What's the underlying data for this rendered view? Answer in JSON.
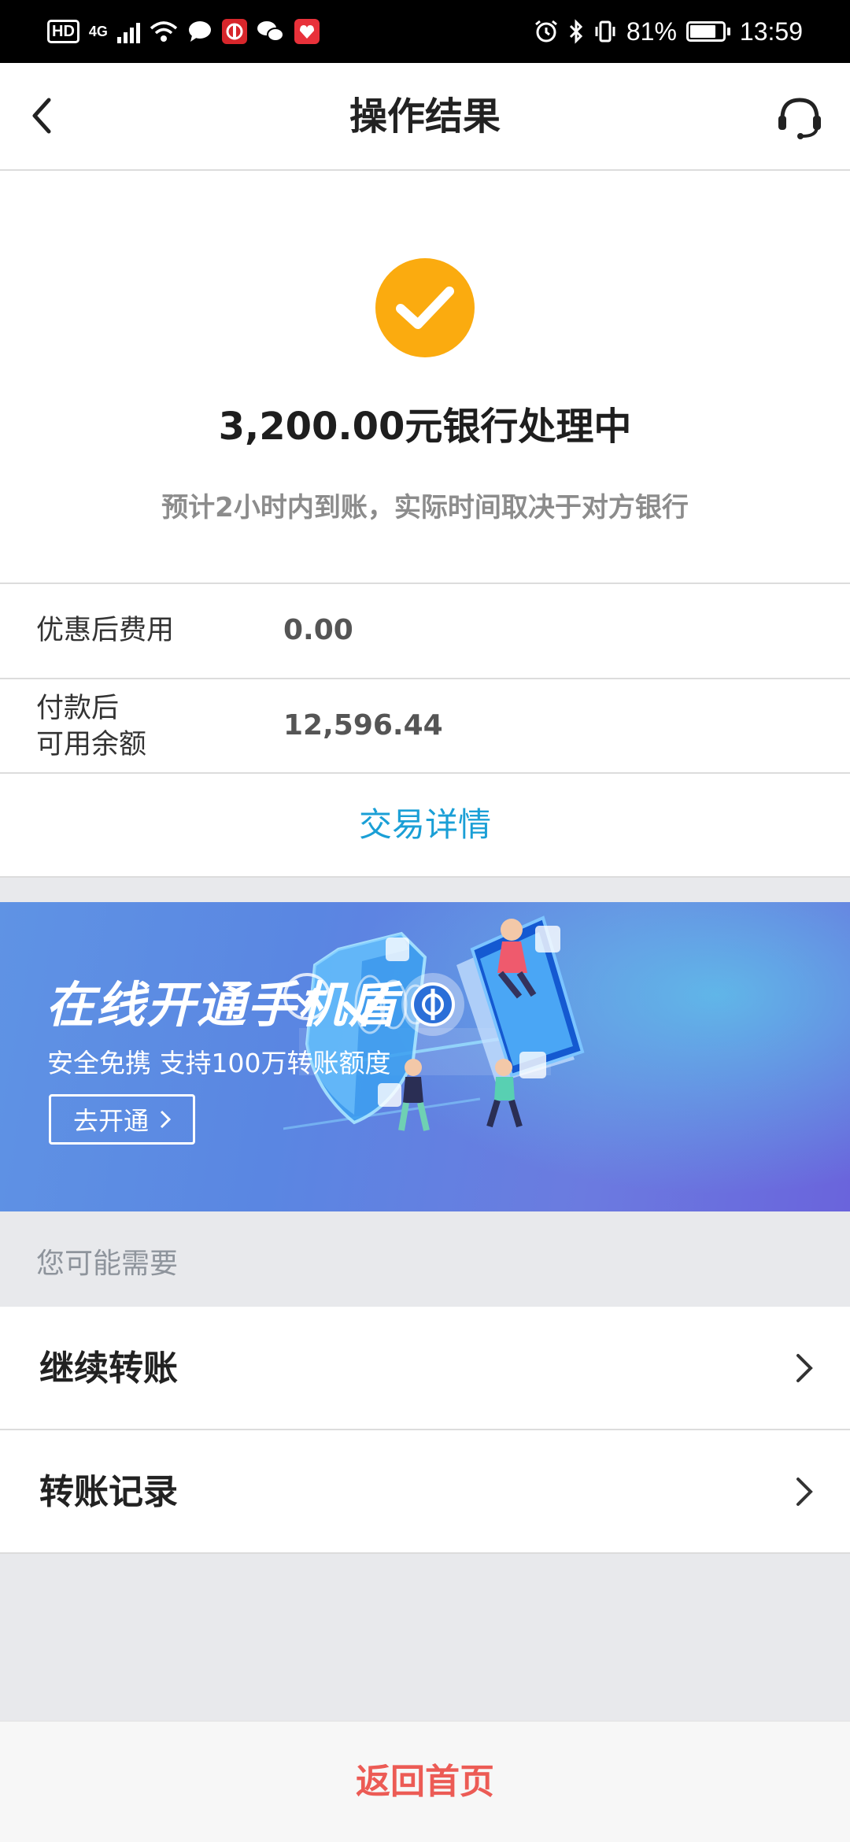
{
  "status_bar": {
    "hd": "HD",
    "network": "4G",
    "battery": "81%",
    "battery_level": 0.81,
    "time": "13:59"
  },
  "nav": {
    "title": "操作结果",
    "back_icon": "chevron-left-icon",
    "support_icon": "headset-icon"
  },
  "result": {
    "status_icon": "check-circle-icon",
    "status_color": "#fbab0f",
    "title": "3,200.00元银行处理中",
    "subtitle": "预计2小时内到账，实际时间取决于对方银行"
  },
  "fees": [
    {
      "label": "优惠后费用",
      "value": "0.00"
    },
    {
      "label_line1": "付款后",
      "label_line2": "可用余额",
      "value": "12,596.44"
    }
  ],
  "detail_link": "交易详情",
  "banner": {
    "title": "在线开通手机盾",
    "subtitle": "安全免携 支持100万转账额度",
    "button": "去开通"
  },
  "suggestions": {
    "header": "您可能需要",
    "items": [
      {
        "label": "继续转账"
      },
      {
        "label": "转账记录"
      }
    ]
  },
  "footer": {
    "home_button": "返回首页",
    "accent": "#ec5b55"
  }
}
